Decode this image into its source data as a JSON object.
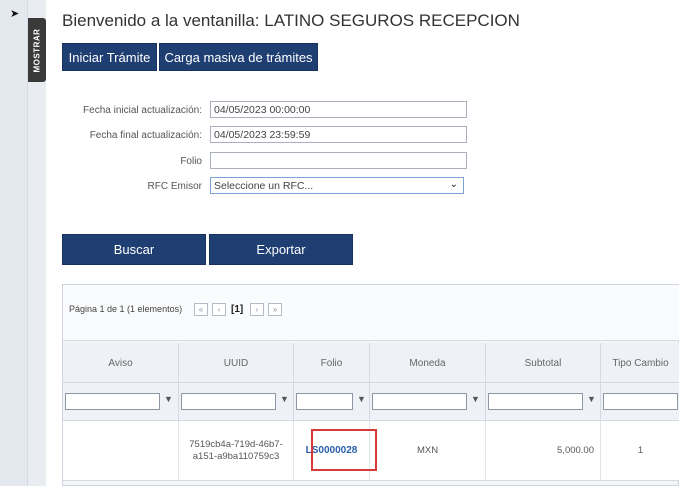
{
  "sidebar": {
    "toggle_label": "MOSTRAR",
    "arrow": "➤"
  },
  "page": {
    "title": "Bienvenido a la ventanilla: LATINO SEGUROS RECEPCION"
  },
  "actions": {
    "iniciar": "Iniciar Trámite",
    "carga": "Carga masiva de trámites"
  },
  "form": {
    "fecha_inicial_label": "Fecha inicial actualización:",
    "fecha_inicial_value": "04/05/2023 00:00:00",
    "fecha_final_label": "Fecha final actualización:",
    "fecha_final_value": "04/05/2023 23:59:59",
    "folio_label": "Folio",
    "folio_value": "",
    "rfc_label": "RFC Emisor",
    "rfc_selected": "Seleccione un RFC..."
  },
  "buttons": {
    "buscar": "Buscar",
    "exportar": "Exportar"
  },
  "pager": {
    "text": "Página 1 de 1 (1 elementos)",
    "current": "[1]",
    "first": "«",
    "prev": "‹",
    "next": "›",
    "last": "»"
  },
  "grid": {
    "columns": [
      "Aviso",
      "UUID",
      "Folio",
      "Moneda",
      "Subtotal",
      "Tipo Cambio"
    ],
    "rows": [
      {
        "aviso": "",
        "uuid": "7519cb4a-719d-46b7-a151-a9ba110759c3",
        "folio": "LS0000028",
        "moneda": "MXN",
        "subtotal": "5,000.00",
        "tipo_cambio": "1"
      }
    ]
  },
  "colors": {
    "primary": "#1f3f73",
    "highlight": "#d83a3a",
    "link": "#2a5fa8"
  }
}
